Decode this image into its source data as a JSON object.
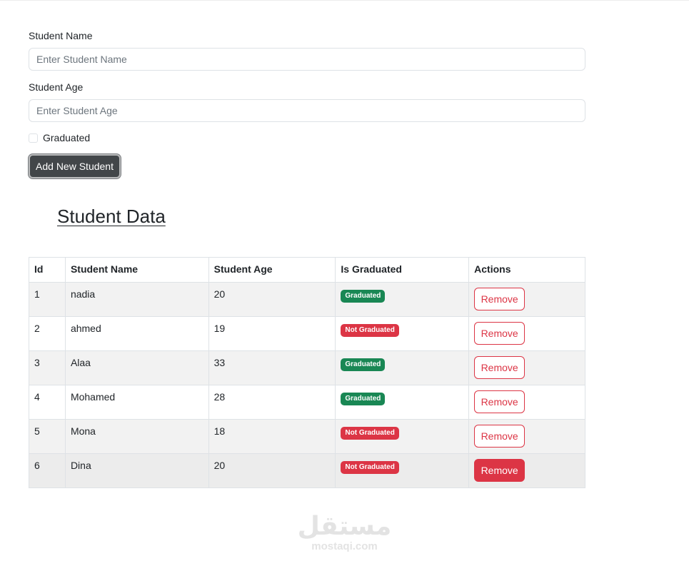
{
  "form": {
    "name_label": "Student Name",
    "name_placeholder": "Enter Student Name",
    "name_value": "",
    "age_label": "Student Age",
    "age_placeholder": "Enter Student Age",
    "age_value": "",
    "graduated_label": "Graduated",
    "graduated_checked": false,
    "add_button_label": "Add New Student"
  },
  "section_title": "Student Data",
  "table": {
    "headers": [
      "Id",
      "Student Name",
      "Student Age",
      "Is Graduated",
      "Actions"
    ],
    "rows": [
      {
        "id": "1",
        "name": "nadia",
        "age": "20",
        "status": "Graduated",
        "action": "Remove"
      },
      {
        "id": "2",
        "name": "ahmed",
        "age": "19",
        "status": "Not Graduated",
        "action": "Remove"
      },
      {
        "id": "3",
        "name": "Alaa",
        "age": "33",
        "status": "Graduated",
        "action": "Remove"
      },
      {
        "id": "4",
        "name": "Mohamed",
        "age": "28",
        "status": "Graduated",
        "action": "Remove"
      },
      {
        "id": "5",
        "name": "Mona",
        "age": "18",
        "status": "Not Graduated",
        "action": "Remove"
      },
      {
        "id": "6",
        "name": "Dina",
        "age": "20",
        "status": "Not Graduated",
        "action": "Remove"
      }
    ]
  },
  "watermark": {
    "logo": "مستقل",
    "url": "mostaqi.com"
  },
  "colors": {
    "graduated": "#198754",
    "not_graduated": "#dc3545",
    "button_dark": "#424649"
  }
}
